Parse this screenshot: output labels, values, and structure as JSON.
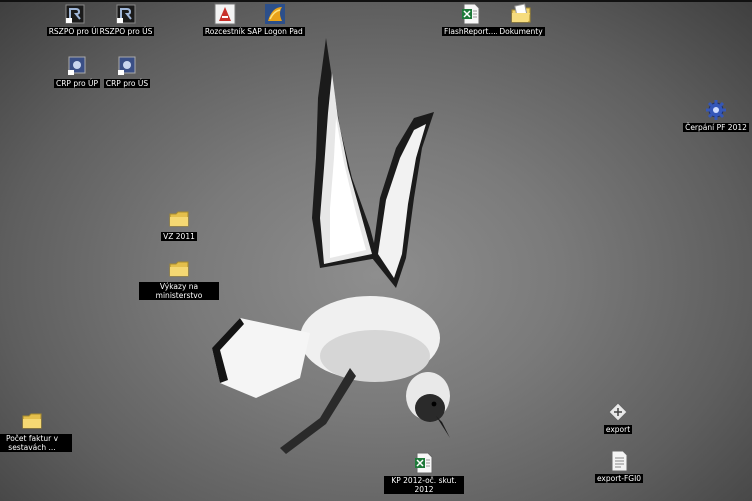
{
  "desktop": {
    "icons": [
      {
        "id": "rszpo-up",
        "label": "RSZPO pro ÚP",
        "icon": "rszpo-shortcut-icon"
      },
      {
        "id": "rszpo-us",
        "label": "RSZPO pro ÚS",
        "icon": "rszpo-shortcut-icon"
      },
      {
        "id": "rozcestnik",
        "label": "Rozcestník",
        "icon": "rozcestnik-icon"
      },
      {
        "id": "sap-logon",
        "label": "SAP Logon Pad",
        "icon": "sap-logon-icon"
      },
      {
        "id": "flashreport",
        "label": "FlashReport....",
        "icon": "excel-file-icon"
      },
      {
        "id": "dokumenty",
        "label": "Dokumenty",
        "icon": "documents-folder-icon"
      },
      {
        "id": "crp-up",
        "label": "CRP pro ÚP",
        "icon": "crp-shortcut-icon"
      },
      {
        "id": "crp-us",
        "label": "CRP pro ÚS",
        "icon": "crp-shortcut-icon"
      },
      {
        "id": "cerpani-pf",
        "label": "Čerpání PF 2012",
        "icon": "gear-icon"
      },
      {
        "id": "vz-2011",
        "label": "VZ 2011",
        "icon": "folder-icon"
      },
      {
        "id": "vykazy",
        "label": "Výkazy na ministerstvo",
        "icon": "folder-icon"
      },
      {
        "id": "pocet-faktur",
        "label": "Počet faktur v sestavách ...",
        "icon": "folder-icon"
      },
      {
        "id": "export",
        "label": "export",
        "icon": "export-file-icon"
      },
      {
        "id": "export-fgi0",
        "label": "export-FGI0",
        "icon": "text-file-icon"
      },
      {
        "id": "kp-2012",
        "label": "KP 2012-oč. skut. 2012",
        "icon": "excel-file-icon"
      }
    ],
    "colors": {
      "label_bg": "#000000",
      "label_fg": "#ffffff",
      "folder": "#f2d36b",
      "excel": "#1f7a3a",
      "sap": "#e8a21a"
    }
  }
}
